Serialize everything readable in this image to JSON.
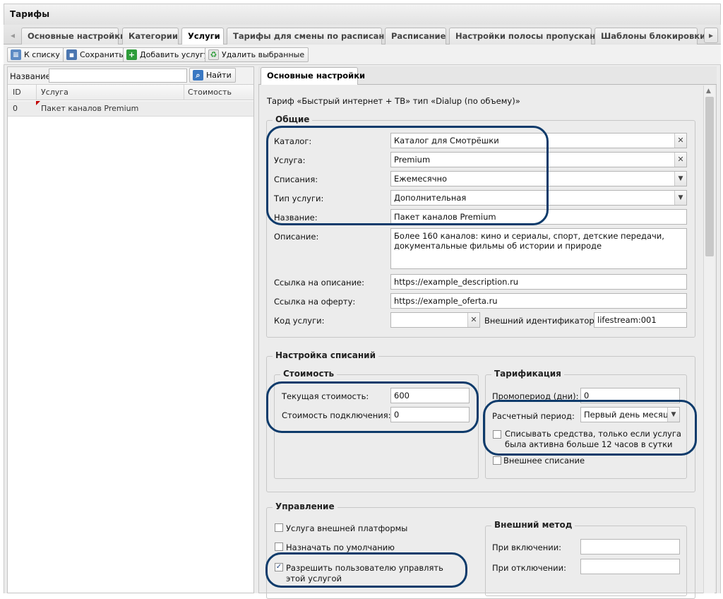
{
  "window": {
    "title": "Тарифы"
  },
  "tabs": [
    "Основные настройки",
    "Категории",
    "Услуги",
    "Тарифы для смены по расписанию",
    "Расписание",
    "Настройки полосы пропускания",
    "Шаблоны блокировки"
  ],
  "active_tab": "Услуги",
  "toolbar": {
    "back_label": "К списку",
    "save_label": "Сохранить",
    "add_label": "Добавить услугу",
    "delete_label": "Удалить выбранные"
  },
  "search": {
    "label": "Название:",
    "value": "",
    "button_label": "Найти"
  },
  "grid": {
    "columns": [
      "ID",
      "Услуга",
      "Стоимость"
    ],
    "rows": [
      {
        "id": "0",
        "service": "Пакет каналов Premium",
        "cost": ""
      }
    ]
  },
  "detail_tab": "Основные настройки",
  "header_text": "Тариф «Быстрый интернет + ТВ» тип «Dialup (по объему)»",
  "general": {
    "legend": "Общие",
    "catalog_label": "Каталог:",
    "catalog_value": "Каталог для Смотрёшки",
    "service_label": "Услуга:",
    "service_value": "Premium",
    "charge_label": "Списания:",
    "charge_value": "Ежемесячно",
    "type_label": "Тип услуги:",
    "type_value": "Дополнительная",
    "name_label": "Название:",
    "name_value": "Пакет каналов Premium",
    "desc_label": "Описание:",
    "desc_value": "Более 160 каналов: кино и сериалы, спорт, детские передачи, документальные фильмы об истории и природе",
    "desc_link_label": "Ссылка на описание:",
    "desc_link_value": "https://example_description.ru",
    "offer_link_label": "Ссылка на оферту:",
    "offer_link_value": "https://example_oferta.ru",
    "code_label": "Код услуги:",
    "code_value": "",
    "ext_id_label": "Внешний идентификатор:",
    "ext_id_value": "lifestream:001"
  },
  "charges": {
    "legend": "Настройка списаний",
    "cost_legend": "Стоимость",
    "current_cost_label": "Текущая стоимость:",
    "current_cost_value": "600",
    "connect_cost_label": "Стоимость подключения:",
    "connect_cost_value": "0",
    "tariff_legend": "Тарификация",
    "promo_label": "Промопериод (дни):",
    "promo_value": "0",
    "period_label": "Расчетный период:",
    "period_value": "Первый день месяца",
    "charge_active_label": "Списывать средства, только если услуга была активна больше 12 часов в сутки",
    "charge_active_checked": false,
    "external_charge_label": "Внешнее списание",
    "external_charge_checked": false
  },
  "management": {
    "legend": "Управление",
    "ext_platform_label": "Услуга внешней платформы",
    "ext_platform_checked": false,
    "default_label": "Назначать по умолчанию",
    "default_checked": false,
    "allow_user_label": "Разрешить пользователю управлять этой услугой",
    "allow_user_checked": true,
    "ext_method_legend": "Внешний метод",
    "on_enable_label": "При включении:",
    "on_enable_value": "",
    "on_disable_label": "При отключении:",
    "on_disable_value": ""
  },
  "colors": {
    "highlight": "#0e3b6b",
    "panel_bg": "#ececec",
    "checkmark": "#1a3d7c"
  }
}
